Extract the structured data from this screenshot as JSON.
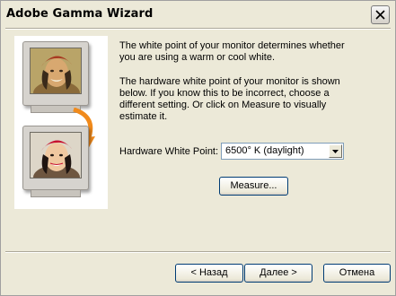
{
  "window": {
    "title": "Adobe Gamma Wizard"
  },
  "illustration": {
    "top_monitor_icon": "portrait-warm-icon",
    "bottom_monitor_icon": "portrait-cool-icon",
    "arrow_color": "#f08a1c"
  },
  "content": {
    "intro_lines": [
      "The white point of your monitor determines whether",
      "you are using a warm or cool white."
    ],
    "detail_lines": [
      "The hardware white point of your monitor is shown",
      "below. If you know this to be incorrect, choose a",
      "different setting. Or click on Measure to visually",
      "estimate it."
    ],
    "hw_label": "Hardware White Point:",
    "hw_value": "6500° K (daylight)",
    "measure_label": "Measure..."
  },
  "footer": {
    "back_label": "< Назад",
    "next_label": "Далее >",
    "cancel_label": "Отмена"
  }
}
